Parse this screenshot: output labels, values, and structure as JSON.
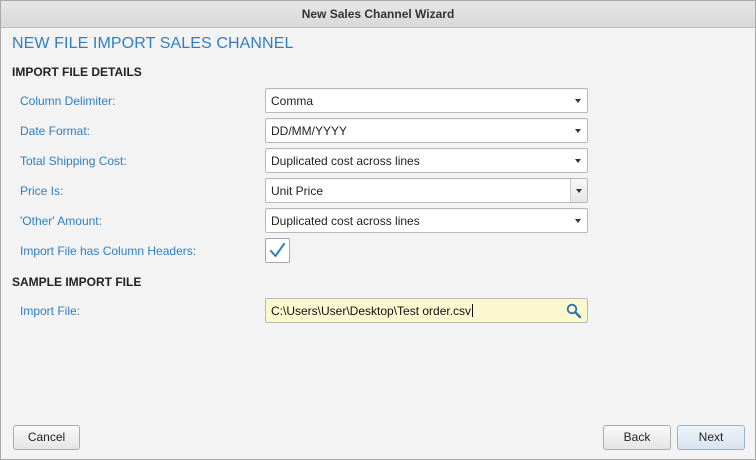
{
  "window": {
    "title": "New Sales Channel Wizard"
  },
  "heading": "NEW FILE IMPORT SALES CHANNEL",
  "sections": {
    "details_title": "IMPORT FILE DETAILS",
    "sample_title": "SAMPLE IMPORT FILE"
  },
  "fields": {
    "column_delimiter": {
      "label": "Column Delimiter:",
      "value": "Comma"
    },
    "date_format": {
      "label": "Date Format:",
      "value": "DD/MM/YYYY"
    },
    "total_shipping_cost": {
      "label": "Total Shipping Cost:",
      "value": "Duplicated cost across lines"
    },
    "price_is": {
      "label": "Price Is:",
      "value": "Unit Price"
    },
    "other_amount": {
      "label": "'Other' Amount:",
      "value": "Duplicated cost across lines"
    },
    "has_headers": {
      "label": "Import File has Column Headers:",
      "checked": true
    },
    "import_file": {
      "label": "Import File:",
      "value": "C:\\Users\\User\\Desktop\\Test order.csv",
      "icon": "search-icon"
    }
  },
  "buttons": {
    "cancel": "Cancel",
    "back": "Back",
    "next": "Next"
  },
  "colors": {
    "accent": "#2f7fc1",
    "file_input_bg": "#fbf8cf"
  }
}
